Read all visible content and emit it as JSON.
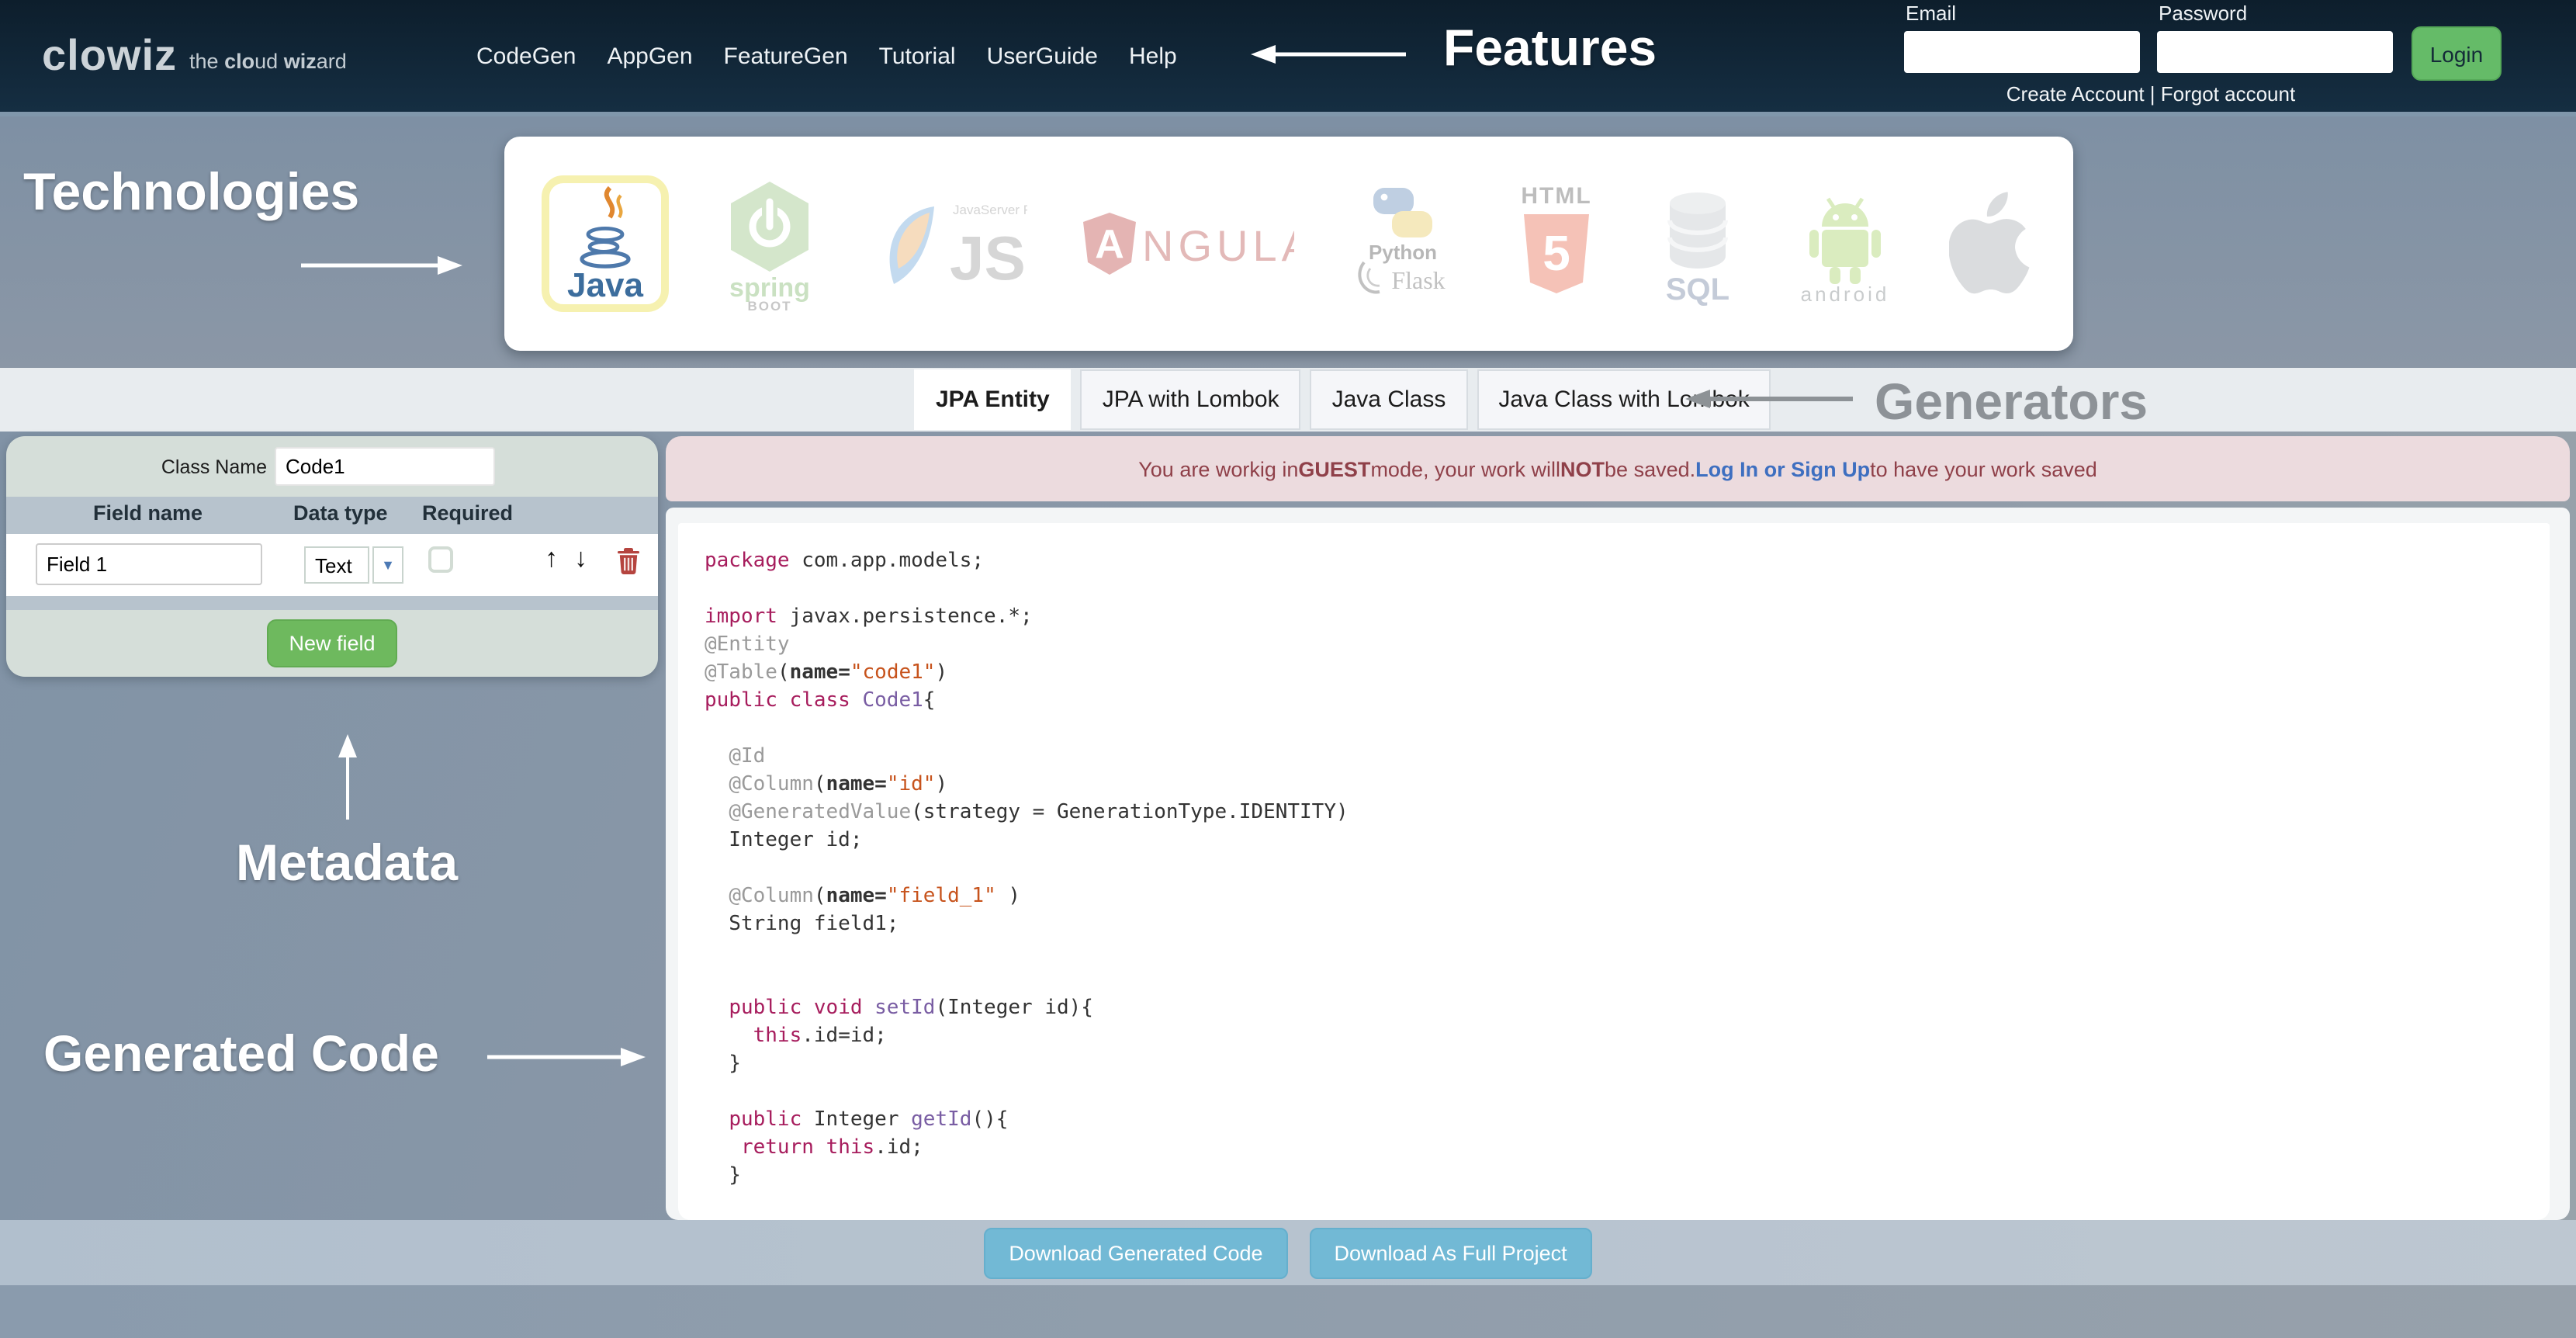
{
  "navbar": {
    "brand": "clowiz",
    "tagline_segments": [
      {
        "t": "the ",
        "c": ""
      },
      {
        "t": "clo",
        "c": "bd"
      },
      {
        "t": "ud ",
        "c": ""
      },
      {
        "t": "wiz",
        "c": "bd"
      },
      {
        "t": "ard",
        "c": ""
      }
    ],
    "items": [
      "CodeGen",
      "AppGen",
      "FeatureGen",
      "Tutorial",
      "UserGuide",
      "Help"
    ],
    "features_annotation": "Features",
    "email_label": "Email",
    "password_label": "Password",
    "email_value": "",
    "password_value": "",
    "login_label": "Login",
    "account_links": "Create Account | Forgot account"
  },
  "technologies": {
    "annotation": "Technologies",
    "items": [
      {
        "name": "java",
        "label": "Java",
        "selected": true
      },
      {
        "name": "spring-boot",
        "label": "spring",
        "sublabel": "BOOT",
        "selected": false
      },
      {
        "name": "jsf",
        "label": "JSF",
        "sublabel": "JavaServer Faces",
        "selected": false
      },
      {
        "name": "angular",
        "label": "NGULAR",
        "sublabel": "A",
        "selected": false
      },
      {
        "name": "python-flask",
        "label": "Python",
        "sublabel": "Flask",
        "selected": false
      },
      {
        "name": "html5",
        "label": "HTML",
        "sublabel": "5",
        "selected": false
      },
      {
        "name": "sql",
        "label": "SQL",
        "selected": false
      },
      {
        "name": "android",
        "label": "android",
        "selected": false
      },
      {
        "name": "apple",
        "label": "",
        "selected": false
      }
    ]
  },
  "generators": {
    "annotation": "Generators",
    "tabs": [
      {
        "label": "JPA Entity",
        "active": true
      },
      {
        "label": "JPA with Lombok",
        "active": false
      },
      {
        "label": "Java Class",
        "active": false
      },
      {
        "label": "Java Class with Lombok",
        "active": false
      }
    ]
  },
  "metadata": {
    "annotation": "Metadata",
    "class_name_label": "Class Name",
    "class_name_value": "Code1",
    "columns": [
      "Field name",
      "Data type",
      "Required"
    ],
    "rows": [
      {
        "field_name": "Field 1",
        "data_type": "Text",
        "required": false
      }
    ],
    "new_field_label": "New field"
  },
  "guest_banner": {
    "segments": [
      {
        "t": "You are workig in ",
        "c": ""
      },
      {
        "t": "GUEST",
        "c": "bd"
      },
      {
        "t": " mode, your work will ",
        "c": ""
      },
      {
        "t": "NOT",
        "c": "bd"
      },
      {
        "t": " be saved. ",
        "c": ""
      },
      {
        "t": "Log In or Sign Up",
        "c": "lnk"
      },
      {
        "t": " to have your work saved",
        "c": ""
      }
    ]
  },
  "generated_code": {
    "annotation": "Generated Code",
    "lines": [
      [
        {
          "t": "package ",
          "c": "k"
        },
        {
          "t": "com.app.models;",
          "c": "p"
        }
      ],
      [],
      [
        {
          "t": "import ",
          "c": "k"
        },
        {
          "t": "javax.persistence.*;",
          "c": "p"
        }
      ],
      [
        {
          "t": "@Entity",
          "c": "an"
        }
      ],
      [
        {
          "t": "@Table",
          "c": "an"
        },
        {
          "t": "(",
          "c": "p"
        },
        {
          "t": "name=",
          "c": "b"
        },
        {
          "t": "\"code1\"",
          "c": "s"
        },
        {
          "t": ")",
          "c": "p"
        }
      ],
      [
        {
          "t": "public class ",
          "c": "k"
        },
        {
          "t": "Code1",
          "c": "nf"
        },
        {
          "t": "{",
          "c": "p"
        }
      ],
      [],
      [
        {
          "t": "  ",
          "c": "p"
        },
        {
          "t": "@Id",
          "c": "an"
        }
      ],
      [
        {
          "t": "  ",
          "c": "p"
        },
        {
          "t": "@Column",
          "c": "an"
        },
        {
          "t": "(",
          "c": "p"
        },
        {
          "t": "name=",
          "c": "b"
        },
        {
          "t": "\"id\"",
          "c": "s"
        },
        {
          "t": ")",
          "c": "p"
        }
      ],
      [
        {
          "t": "  ",
          "c": "p"
        },
        {
          "t": "@GeneratedValue",
          "c": "an"
        },
        {
          "t": "(strategy = GenerationType.IDENTITY)",
          "c": "p"
        }
      ],
      [
        {
          "t": "  Integer id;",
          "c": "p"
        }
      ],
      [],
      [
        {
          "t": "  ",
          "c": "p"
        },
        {
          "t": "@Column",
          "c": "an"
        },
        {
          "t": "(",
          "c": "p"
        },
        {
          "t": "name=",
          "c": "b"
        },
        {
          "t": "\"field_1\"",
          "c": "s"
        },
        {
          "t": " )",
          "c": "p"
        }
      ],
      [
        {
          "t": "  String field1;",
          "c": "p"
        }
      ],
      [],
      [],
      [
        {
          "t": "  ",
          "c": "p"
        },
        {
          "t": "public void ",
          "c": "k"
        },
        {
          "t": "setId",
          "c": "nf"
        },
        {
          "t": "(Integer id){",
          "c": "p"
        }
      ],
      [
        {
          "t": "    ",
          "c": "p"
        },
        {
          "t": "this",
          "c": "k"
        },
        {
          "t": ".id=id;",
          "c": "p"
        }
      ],
      [
        {
          "t": "  }",
          "c": "p"
        }
      ],
      [],
      [
        {
          "t": "  ",
          "c": "p"
        },
        {
          "t": "public ",
          "c": "k"
        },
        {
          "t": "Integer ",
          "c": "p"
        },
        {
          "t": "getId",
          "c": "nf"
        },
        {
          "t": "(){",
          "c": "p"
        }
      ],
      [
        {
          "t": "   ",
          "c": "p"
        },
        {
          "t": "return ",
          "c": "k"
        },
        {
          "t": "this",
          "c": "k"
        },
        {
          "t": ".id;",
          "c": "p"
        }
      ],
      [
        {
          "t": "  }",
          "c": "p"
        }
      ]
    ]
  },
  "downloads": {
    "generated_label": "Download Generated Code",
    "full_label": "Download As Full Project"
  },
  "colors": {
    "navbar_bg": "#112536",
    "page_bg": "#8a98a8",
    "accent_green": "#65bb68",
    "new_field_green": "#6eb95e",
    "download_blue": "#72b9d5",
    "warning_bg": "#ecdbde",
    "warning_text": "#8f4049",
    "link_blue": "#3e6fc0",
    "java_selected_border": "#f6f1b0",
    "code_keyword": "#a71d5d",
    "code_string": "#c7531c",
    "code_annotation": "#9a9a9a",
    "code_name": "#795da3"
  }
}
